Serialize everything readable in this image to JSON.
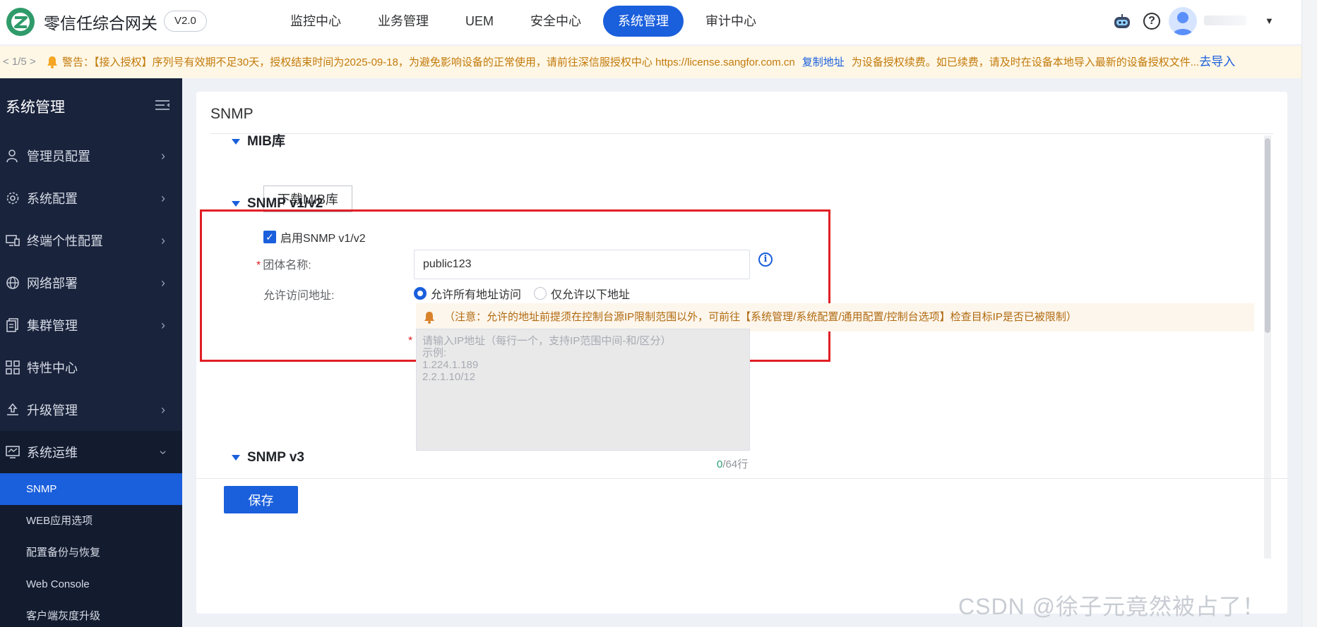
{
  "header": {
    "title": "零信任综合网关",
    "version": "V2.0",
    "nav": [
      {
        "label": "监控中心"
      },
      {
        "label": "业务管理"
      },
      {
        "label": "UEM"
      },
      {
        "label": "安全中心"
      },
      {
        "label": "系统管理",
        "active": true
      },
      {
        "label": "审计中心"
      }
    ],
    "help_glyph": "?",
    "icons": [
      "robot-icon",
      "help-icon",
      "avatar",
      "caret-down-icon"
    ]
  },
  "notice": {
    "pager": "< 1/5 >",
    "prefix": "警告：",
    "text": "【接入授权】序列号有效期不足30天，授权结束时间为2025-09-18，为避免影响设备的正常使用，请前往深信服授权中心 https://license.sangfor.com.cn",
    "copy_link": "复制地址",
    "text2": "为设备授权续费。如已续费，请及时在设备本地导入最新的设备授权文件...",
    "import_link": "去导入"
  },
  "sidebar": {
    "title": "系统管理",
    "items": [
      {
        "label": "管理员配置",
        "icon": "admin-user-icon"
      },
      {
        "label": "系统配置",
        "icon": "gear-icon"
      },
      {
        "label": "终端个性配置",
        "icon": "monitor-icon"
      },
      {
        "label": "网络部署",
        "icon": "globe-icon"
      },
      {
        "label": "集群管理",
        "icon": "cluster-icon"
      },
      {
        "label": "特性中心",
        "icon": "grid-icon"
      },
      {
        "label": "升级管理",
        "icon": "upgrade-icon"
      },
      {
        "label": "系统运维",
        "icon": "ops-monitor-icon",
        "open": true
      }
    ],
    "sub_items": [
      {
        "label": "SNMP",
        "active": true
      },
      {
        "label": "WEB应用选项"
      },
      {
        "label": "配置备份与恢复"
      },
      {
        "label": "Web Console"
      },
      {
        "label": "客户端灰度升级"
      }
    ]
  },
  "main": {
    "title": "SNMP",
    "mib": {
      "section": "MIB库",
      "download_button": "下载MIB库"
    },
    "v1v2": {
      "section": "SNMP v1/v2",
      "enable_label": "启用SNMP v1/v2",
      "enabled": true,
      "community_label": "团体名称:",
      "community_value": "public123",
      "required_mark": "*",
      "access_label": "允许访问地址:",
      "radio_all": "允许所有地址访问",
      "radio_only": "仅允许以下地址",
      "selected": "all",
      "tip": "（注意：允许的地址前提须在控制台源IP限制范围以外，可前往【系统管理/系统配置/通用配置/控制台选项】检查目标IP是否已被限制）",
      "ip_placeholder": "请输入IP地址（每行一个，支持IP范围中间-和/区分）\n示例:\n1.224.1.189\n2.2.1.10/12",
      "counter_num": "0",
      "counter_suffix": "/64行"
    },
    "v3": {
      "section": "SNMP v3"
    },
    "save_button": "保存"
  },
  "watermark": "CSDN @徐子元竟然被占了！",
  "colors": {
    "primary": "#1a5fdc",
    "sidebar_bg": "#19233c",
    "highlight_border": "#e01f25",
    "warning": "#c17a0a"
  }
}
